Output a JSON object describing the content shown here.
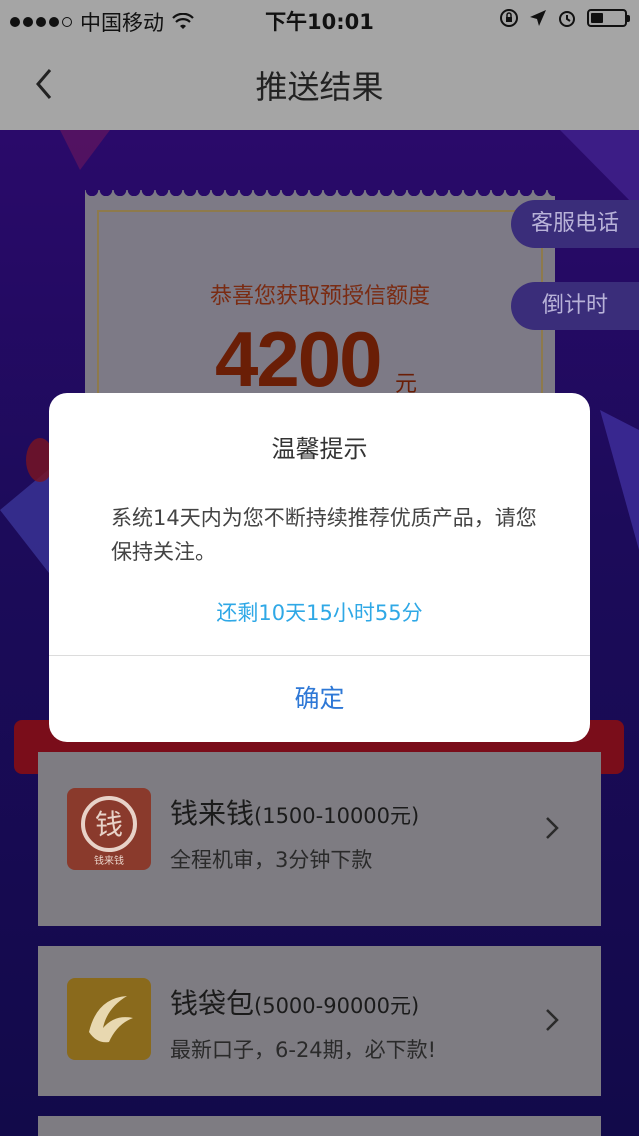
{
  "status_bar": {
    "carrier": "中国移动",
    "time": "下午10:01"
  },
  "nav": {
    "title": "推送结果"
  },
  "certificate": {
    "headline": "恭喜您获取预授信额度",
    "amount": "4200",
    "unit": "元"
  },
  "side_buttons": {
    "service": "客服电话",
    "countdown": "倒计时"
  },
  "products": [
    {
      "name": "钱来钱",
      "range": "(1500-10000元)",
      "desc": "全程机审，3分钟下款",
      "logo_text": "钱",
      "logo_sub": "钱来钱"
    },
    {
      "name": "钱袋包",
      "range": "(5000-90000元)",
      "desc": "最新口子，6-24期，必下款!"
    }
  ],
  "dialog": {
    "title": "温馨提示",
    "message": "系统14天内为您不断持续推荐优质产品，请您保持关注。",
    "countdown": "还剩10天15小时55分",
    "confirm": "确定"
  },
  "colors": {
    "accent_blue": "#2e78d6",
    "countdown_blue": "#2fa8e6",
    "amount_red": "#c0390b"
  }
}
